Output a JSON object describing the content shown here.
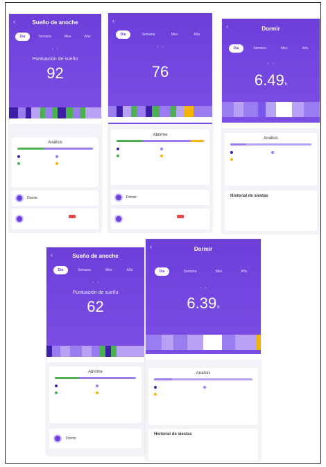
{
  "colors": {
    "primary": "#6d3fd9",
    "light_purple": "#9b7cf0",
    "deep": "#3c1fa6",
    "green": "#4caf50",
    "yellow": "#f4b400",
    "red": "#e84a4a"
  },
  "common": {
    "back_icon": "chevron-left-icon",
    "tabs": [
      "Dia",
      "Semana",
      "Mes",
      "Año"
    ]
  },
  "screens": [
    {
      "id": "s1",
      "title": "Sueño de anoche",
      "label": "Puntuación de sueño",
      "value": "92",
      "panel_title": "Análisis",
      "section_label": "Dormir"
    },
    {
      "id": "s2",
      "value": "76",
      "panel_title": "Abrirme",
      "section_label": "Dormir"
    },
    {
      "id": "s3",
      "title": "Dormir",
      "value": "6.49",
      "unit": "h",
      "panel_title": "Análisis",
      "section_title": "Historial de siestas"
    },
    {
      "id": "s4",
      "title": "Sueño de anoche",
      "label": "Puntuación de sueño",
      "value": "62",
      "panel_title": "Abrirme",
      "section_label": "Dormir"
    },
    {
      "id": "s5",
      "title": "Dormir",
      "value": "6.39",
      "unit": "h",
      "panel_title": "Análisis",
      "section_title": "Historial de siestas"
    }
  ]
}
